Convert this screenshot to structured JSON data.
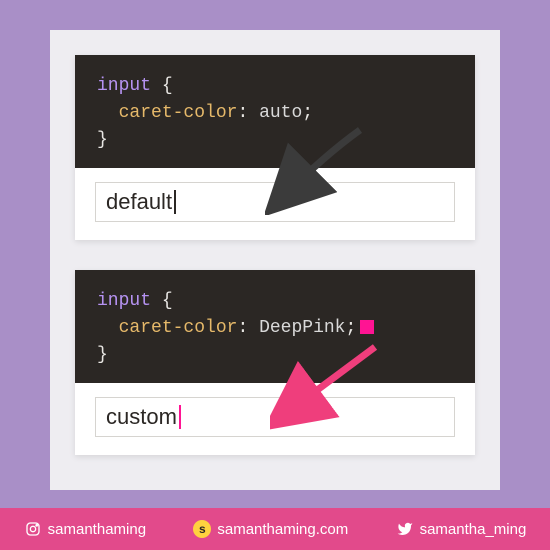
{
  "blocks": [
    {
      "selector": "input",
      "property": "caret-color",
      "value": "auto",
      "swatch": false,
      "input_text": "default",
      "caret_class": "caret-default"
    },
    {
      "selector": "input",
      "property": "caret-color",
      "value": "DeepPink",
      "swatch": true,
      "input_text": "custom",
      "caret_class": "caret-pink"
    }
  ],
  "footer": {
    "instagram": "samanthaming",
    "site": "samanthaming.com",
    "twitter": "samantha_ming"
  },
  "colors": {
    "bg": "#a98fc7",
    "panel": "#eeedf1",
    "code_bg": "#2b2724",
    "accent": "#e24a8b",
    "deeppink": "#ff1493"
  }
}
